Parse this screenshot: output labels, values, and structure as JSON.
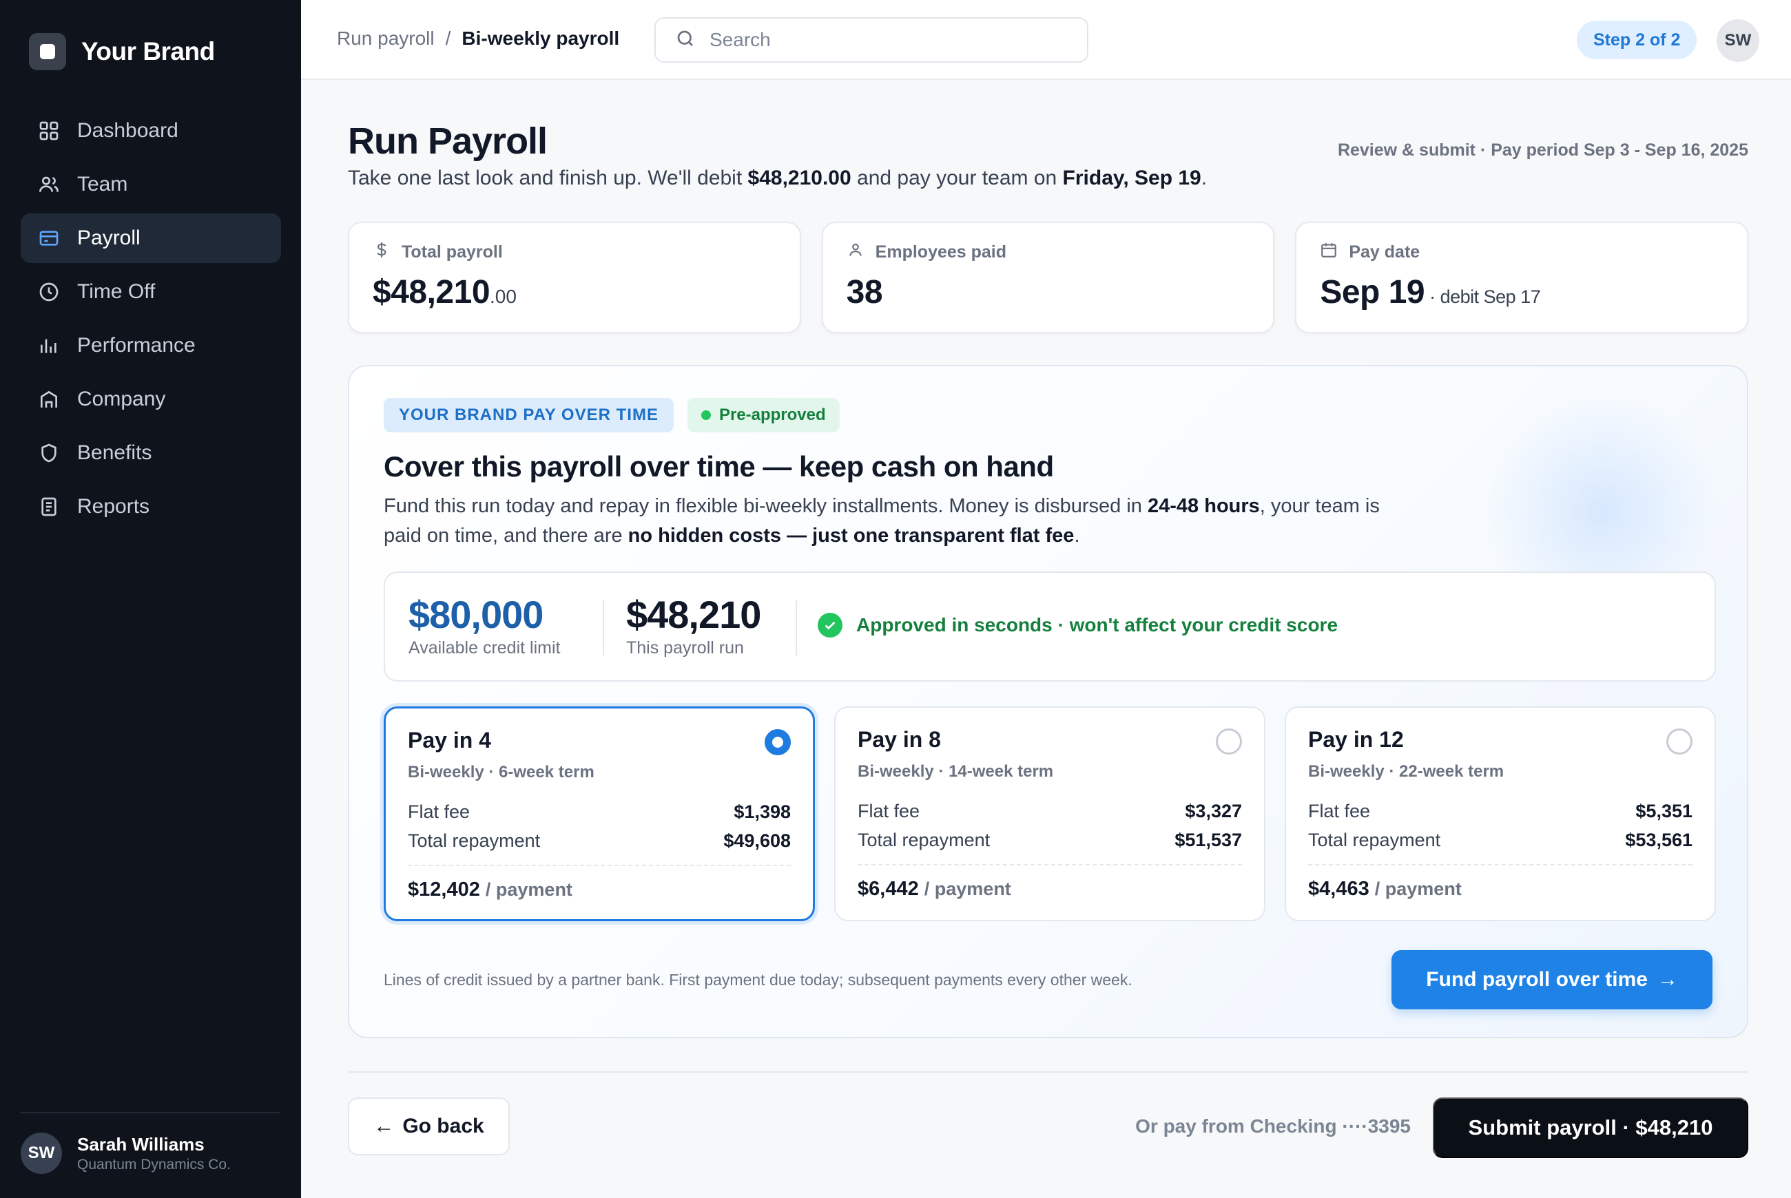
{
  "brand": {
    "name": "Your Brand"
  },
  "sidebar": {
    "items": [
      {
        "label": "Dashboard",
        "icon": "grid-icon"
      },
      {
        "label": "Team",
        "icon": "users-icon"
      },
      {
        "label": "Payroll",
        "icon": "credit-card-icon",
        "active": true
      },
      {
        "label": "Time Off",
        "icon": "clock-icon"
      },
      {
        "label": "Performance",
        "icon": "bar-chart-icon"
      },
      {
        "label": "Company",
        "icon": "building-icon"
      },
      {
        "label": "Benefits",
        "icon": "shield-icon"
      },
      {
        "label": "Reports",
        "icon": "document-icon"
      }
    ],
    "user": {
      "initials": "SW",
      "name": "Sarah Williams",
      "org": "Quantum Dynamics Co."
    }
  },
  "topbar": {
    "crumb_parent": "Run payroll",
    "crumb_sep": "/",
    "crumb_current": "Bi-weekly payroll",
    "search_placeholder": "Search",
    "step": "Step 2 of 2",
    "avatar_initials": "SW"
  },
  "page": {
    "title": "Run Payroll",
    "meta": "Review & submit · Pay period Sep 3 - Sep 16, 2025",
    "sub_pre": "Take one last look and finish up. We'll debit ",
    "sub_amount": "$48,210.00",
    "sub_mid": " and pay your team on ",
    "sub_date": "Friday, Sep 19",
    "sub_end": "."
  },
  "stats": {
    "total_label": "Total payroll",
    "total_main": "$48,210",
    "total_cents": ".00",
    "employees_label": "Employees paid",
    "employees_value": "38",
    "paydate_label": "Pay date",
    "paydate_value": "Sep 19",
    "paydate_aside": " · debit Sep 17"
  },
  "offer": {
    "badge": "YOUR BRAND PAY OVER TIME",
    "preapproved": "Pre-approved",
    "title": "Cover this payroll over time — keep cash on hand",
    "desc_1": "Fund this run today and repay in flexible bi-weekly installments. Money is disbursed in ",
    "desc_bold_1": "24-48 hours",
    "desc_2": ", your team is paid on time, and there are ",
    "desc_bold_2": "no hidden costs — just one transparent flat fee",
    "desc_3": ".",
    "credit_limit": "$80,000",
    "credit_limit_label": "Available credit limit",
    "run_amount": "$48,210",
    "run_label": "This payroll run",
    "approved_text": "Approved in seconds · won't affect your credit score",
    "plans": [
      {
        "name": "Pay in 4",
        "term": "Bi-weekly · 6-week term",
        "fee_label": "Flat fee",
        "fee": "$1,398",
        "total_label": "Total repayment",
        "total": "$49,608",
        "payment": "$12,402",
        "payment_suffix": "/ payment",
        "selected": true
      },
      {
        "name": "Pay in 8",
        "term": "Bi-weekly · 14-week term",
        "fee_label": "Flat fee",
        "fee": "$3,327",
        "total_label": "Total repayment",
        "total": "$51,537",
        "payment": "$6,442",
        "payment_suffix": "/ payment",
        "selected": false
      },
      {
        "name": "Pay in 12",
        "term": "Bi-weekly · 22-week term",
        "fee_label": "Flat fee",
        "fee": "$5,351",
        "total_label": "Total repayment",
        "total": "$53,561",
        "payment": "$4,463",
        "payment_suffix": "/ payment",
        "selected": false
      }
    ],
    "disclaimer": "Lines of credit issued by a partner bank. First payment due today; subsequent payments every other week.",
    "fund_button": "Fund payroll over time"
  },
  "footer": {
    "back": "Go back",
    "pay_from": "Or pay from Checking ····3395",
    "submit": "Submit payroll · $48,210"
  },
  "colors": {
    "accent": "#1f82e6",
    "sidebar_bg": "#0f141c",
    "success": "#15803d",
    "credit_blue": "#1d5fa8"
  }
}
